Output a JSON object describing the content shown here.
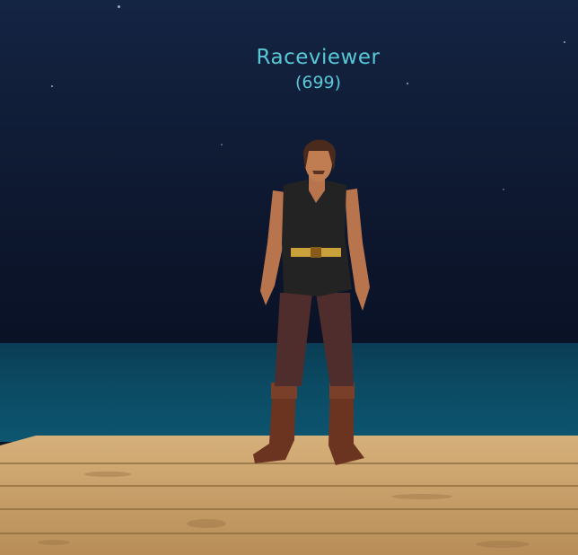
{
  "npc": {
    "name": "Raceviewer",
    "level": "(699)"
  },
  "colors": {
    "sky": "#101c36",
    "sea": "#0b4a62",
    "deck": "#c49a62",
    "nameplate": "#58c8d6"
  }
}
